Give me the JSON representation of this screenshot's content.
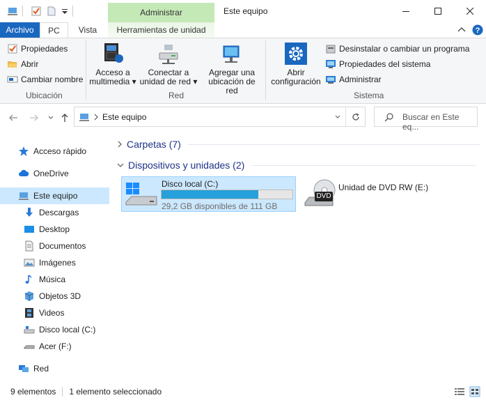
{
  "titlebar": {
    "context_tab_header": "Administrar",
    "window_title": "Este equipo"
  },
  "tabs": {
    "archivo": "Archivo",
    "pc": "PC",
    "vista": "Vista",
    "herramientas": "Herramientas de unidad"
  },
  "ribbon": {
    "ubicacion": {
      "propiedades": "Propiedades",
      "abrir": "Abrir",
      "cambiar_nombre": "Cambiar nombre",
      "label": "Ubicación"
    },
    "red": {
      "acceso_l1": "Acceso a",
      "acceso_l2": "multimedia",
      "conectar_l1": "Conectar a",
      "conectar_l2": "unidad de red",
      "agregar_l1": "Agregar una",
      "agregar_l2": "ubicación de red",
      "label": "Red"
    },
    "sistema": {
      "abrir_l1": "Abrir",
      "abrir_l2": "configuración",
      "desinstalar": "Desinstalar o cambiar un programa",
      "propiedades_sistema": "Propiedades del sistema",
      "administrar": "Administrar",
      "label": "Sistema"
    }
  },
  "address": {
    "path": "Este equipo",
    "search_placeholder": "Buscar en Este eq..."
  },
  "nav": {
    "items": [
      "Acceso rápido",
      "OneDrive",
      "Este equipo",
      "Descargas",
      "Desktop",
      "Documentos",
      "Imágenes",
      "Música",
      "Objetos 3D",
      "Videos",
      "Disco local (C:)",
      "Acer (F:)",
      "Red"
    ]
  },
  "content": {
    "folders_header": "Carpetas (7)",
    "devices_header": "Dispositivos y unidades (2)",
    "drive_c": {
      "name": "Disco local (C:)",
      "free": "29,2 GB disponibles de 111 GB",
      "used_fraction": 0.737
    },
    "dvd": {
      "name": "Unidad de DVD RW (E:)",
      "badge": "DVD"
    }
  },
  "status": {
    "count": "9 elementos",
    "selected": "1 elemento seleccionado"
  },
  "colors": {
    "accent": "#1a67c0",
    "selection": "#cce8ff",
    "context_tab": "#c5e8b7",
    "progress": "#26a0da"
  }
}
